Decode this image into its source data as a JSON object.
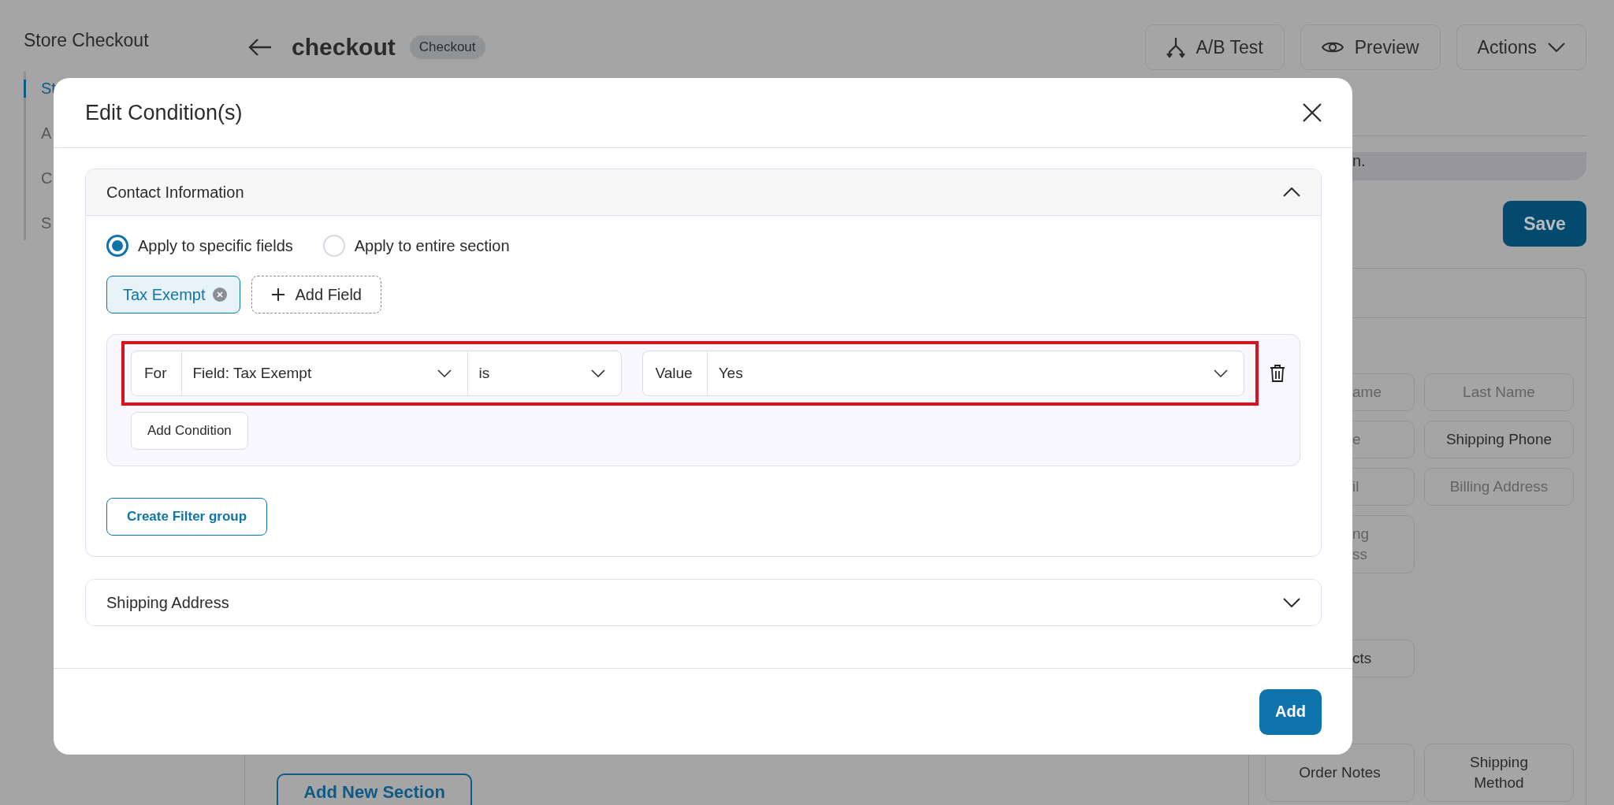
{
  "sidebar": {
    "title": "Store Checkout",
    "items": [
      {
        "label": "St",
        "selected": true
      },
      {
        "label": "A",
        "selected": false
      },
      {
        "label": "C",
        "selected": false
      },
      {
        "label": "S",
        "selected": false
      }
    ]
  },
  "header": {
    "title": "checkout",
    "badge": "Checkout",
    "buttons": [
      {
        "kind": "ab",
        "label": "A/B Test"
      },
      {
        "kind": "preview",
        "label": "Preview"
      },
      {
        "kind": "actions",
        "label": "Actions"
      }
    ]
  },
  "notice": "n.",
  "save_button": "Save",
  "field_panel": {
    "groups": [
      [
        {
          "label": "ame",
          "disabled": true
        },
        {
          "label": "Last Name",
          "disabled": true
        }
      ],
      [
        {
          "label": "e",
          "disabled": true
        },
        {
          "label": "Shipping Phone",
          "disabled": false
        }
      ],
      [
        {
          "label": "il",
          "disabled": true
        },
        {
          "label": "Billing Address",
          "disabled": true
        }
      ],
      [
        {
          "label": "ng\nss",
          "disabled": true
        }
      ],
      [
        {
          "label": "cts",
          "disabled": false
        }
      ],
      [
        {
          "label": "Order Notes",
          "disabled": false
        },
        {
          "label": "Shipping\nMethod",
          "disabled": false
        }
      ]
    ]
  },
  "add_section_button": "Add New Section",
  "modal": {
    "title": "Edit Condition(s)",
    "sections": [
      {
        "title": "Contact Information",
        "expanded": true,
        "apply_options": [
          {
            "label": "Apply to specific fields",
            "selected": true
          },
          {
            "label": "Apply to entire section",
            "selected": false
          }
        ],
        "fields": [
          {
            "label": "Tax Exempt"
          }
        ],
        "add_field_button": "Add Field",
        "conditions": [
          {
            "for_label": "For",
            "field": "Field: Tax Exempt",
            "operator": "is",
            "value_label": "Value",
            "value": "Yes",
            "highlighted": true
          }
        ],
        "add_condition_button": "Add Condition",
        "create_group_button": "Create Filter group"
      },
      {
        "title": "Shipping Address",
        "expanded": false
      }
    ],
    "add_button": "Add"
  }
}
